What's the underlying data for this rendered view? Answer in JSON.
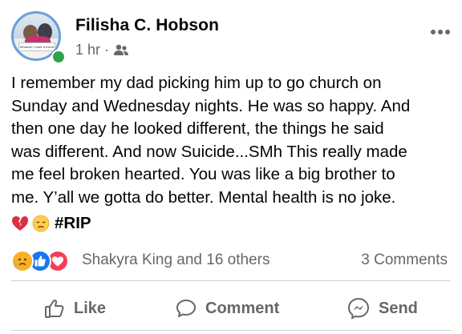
{
  "post": {
    "author": "Filisha C. Hobson",
    "time": "1 hr",
    "separator": "·",
    "audience_icon": "friends-icon",
    "more_icon": "more-options-icon",
    "avatar_banner_text": "Whoever I have a friend",
    "text": "I remember my dad picking him up to go church on\nSunday and Wednesday nights. He was so happy. And\nthen one day he looked different, the things he said\nwas different. And now Suicide...SMh This really made\nme feel broken hearted. You was like a big brother to\nme. Y’all we gotta do better. Mental health is no joke.",
    "emoji_icons": [
      "broken-heart-emoji",
      "disappointed-face-emoji"
    ],
    "hashtag": "#RIP"
  },
  "reactions": {
    "icons": [
      "care-reaction-icon",
      "like-reaction-icon",
      "love-reaction-icon"
    ],
    "summary": "Shakyra King and 16 others",
    "comments": "3 Comments"
  },
  "actions": {
    "like": "Like",
    "comment": "Comment",
    "send": "Send"
  },
  "colors": {
    "secondary_text": "#65676b",
    "like_blue": "#1877f2",
    "love_red": "#f33e58",
    "care_yellow": "#f7b125",
    "online_green": "#31a24c"
  }
}
